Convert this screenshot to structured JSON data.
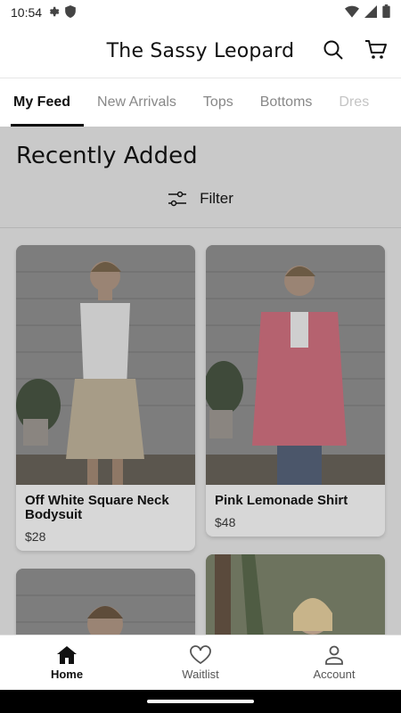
{
  "status": {
    "time": "10:54"
  },
  "header": {
    "title": "The Sassy Leopard"
  },
  "tabs": [
    {
      "label": "My Feed",
      "active": true
    },
    {
      "label": "New Arrivals",
      "active": false
    },
    {
      "label": "Tops",
      "active": false
    },
    {
      "label": "Bottoms",
      "active": false
    },
    {
      "label": "Dres",
      "active": false
    }
  ],
  "feed": {
    "title": "Recently Added",
    "filter_label": "Filter",
    "products": [
      {
        "name": "Off White Square Neck Bodysuit",
        "price": "$28"
      },
      {
        "name": "Pink Lemonade Shirt",
        "price": "$48"
      }
    ]
  },
  "bottom_nav": {
    "items": [
      {
        "label": "Home",
        "icon": "home-icon",
        "active": true
      },
      {
        "label": "Waitlist",
        "icon": "heart-icon",
        "active": false
      },
      {
        "label": "Account",
        "icon": "person-icon",
        "active": false
      }
    ]
  },
  "colors": {
    "accent": "#111111",
    "overlay": "#c9c9c9"
  }
}
